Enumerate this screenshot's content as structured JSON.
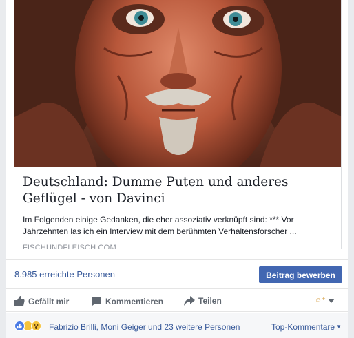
{
  "link_preview": {
    "title": "Deutschland: Dumme Puten und anderes Geflügel - von Davinci",
    "description": "Im Folgenden einige Gedanken, die eher assoziativ verknüpft sind: *** Vor Jahrzehnten las ich ein Interview mit dem berühmten Verhaltensforscher ...",
    "domain": "FISCHUNDFLEISCH.COM",
    "image_icon": "portrait-image"
  },
  "reach": {
    "text": "8.985 erreichte Personen",
    "boost_label": "Beitrag bewerben"
  },
  "actions": {
    "like_label": "Gefällt mir",
    "comment_label": "Kommentieren",
    "share_label": "Teilen"
  },
  "reactions": {
    "names_text": "Fabrizio Brilli, Moni Geiger und 23 weitere Personen",
    "sort_label": "Top-Kommentare"
  },
  "colors": {
    "link_blue": "#365899",
    "button_blue": "#4267b2",
    "muted_gray": "#90949c"
  }
}
